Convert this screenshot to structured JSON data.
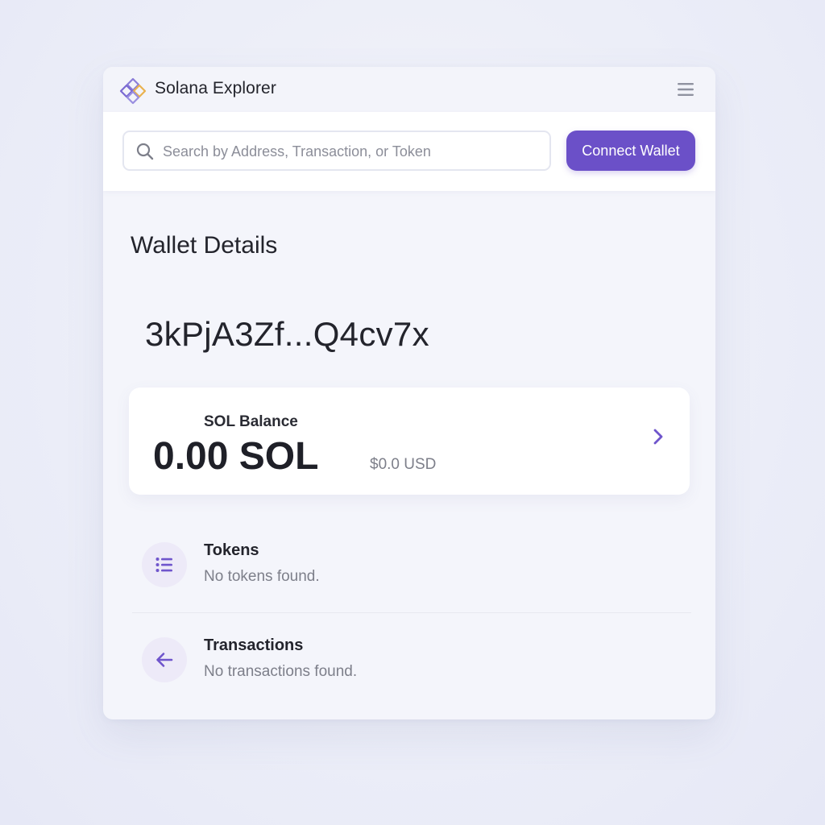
{
  "header": {
    "app_title": "Solana Explorer",
    "logo_icon": "solana-diamond-logo-icon",
    "menu_icon": "hamburger-menu-icon"
  },
  "search": {
    "placeholder": "Search by Address, Transaction, or Token",
    "value": "",
    "icon": "search-icon"
  },
  "connect_button": {
    "label": "Connect Wallet"
  },
  "wallet": {
    "heading": "Wallet Details",
    "address": "3kPjA3Zf...Q4cv7x"
  },
  "balance": {
    "label": "SOL Balance",
    "value": "0.00 SOL",
    "usd": "$0.0 USD",
    "icon": "chevron-right-icon"
  },
  "sections": [
    {
      "title": "Tokens",
      "subtitle": "No tokens found.",
      "icon": "list-icon"
    },
    {
      "title": "Transactions",
      "subtitle": "No transactions found.",
      "icon": "arrow-left-icon"
    }
  ],
  "colors": {
    "accent": "#6b50c8",
    "icon_accent": "#6f55cc",
    "icon_bg": "#edeaf8",
    "page_bg": "#eceef8",
    "text_primary": "#23242c",
    "text_muted": "#7d7f8a"
  }
}
